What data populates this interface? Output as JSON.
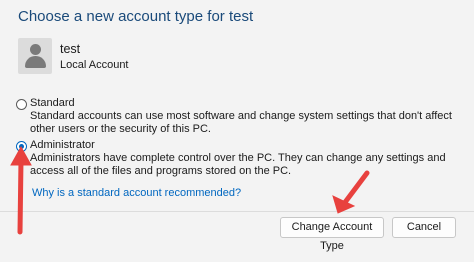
{
  "dialog": {
    "title": "Choose a new account type for test",
    "account": {
      "name": "test",
      "type": "Local Account",
      "avatar_icon": "user-icon"
    },
    "options": [
      {
        "label": "Standard",
        "description": "Standard accounts can use most software and change system settings that don't affect other users or the security of this PC.",
        "selected": false
      },
      {
        "label": "Administrator",
        "description": "Administrators have complete control over the PC. They can change any settings and access all of the files and programs stored on the PC.",
        "selected": true
      }
    ],
    "link": "Why is a standard account recommended?",
    "buttons": {
      "change": "Change Account Type",
      "cancel": "Cancel"
    },
    "colors": {
      "title": "#1a4a7a",
      "accent": "#0067c0",
      "annotation_arrow": "#e8413e"
    }
  }
}
